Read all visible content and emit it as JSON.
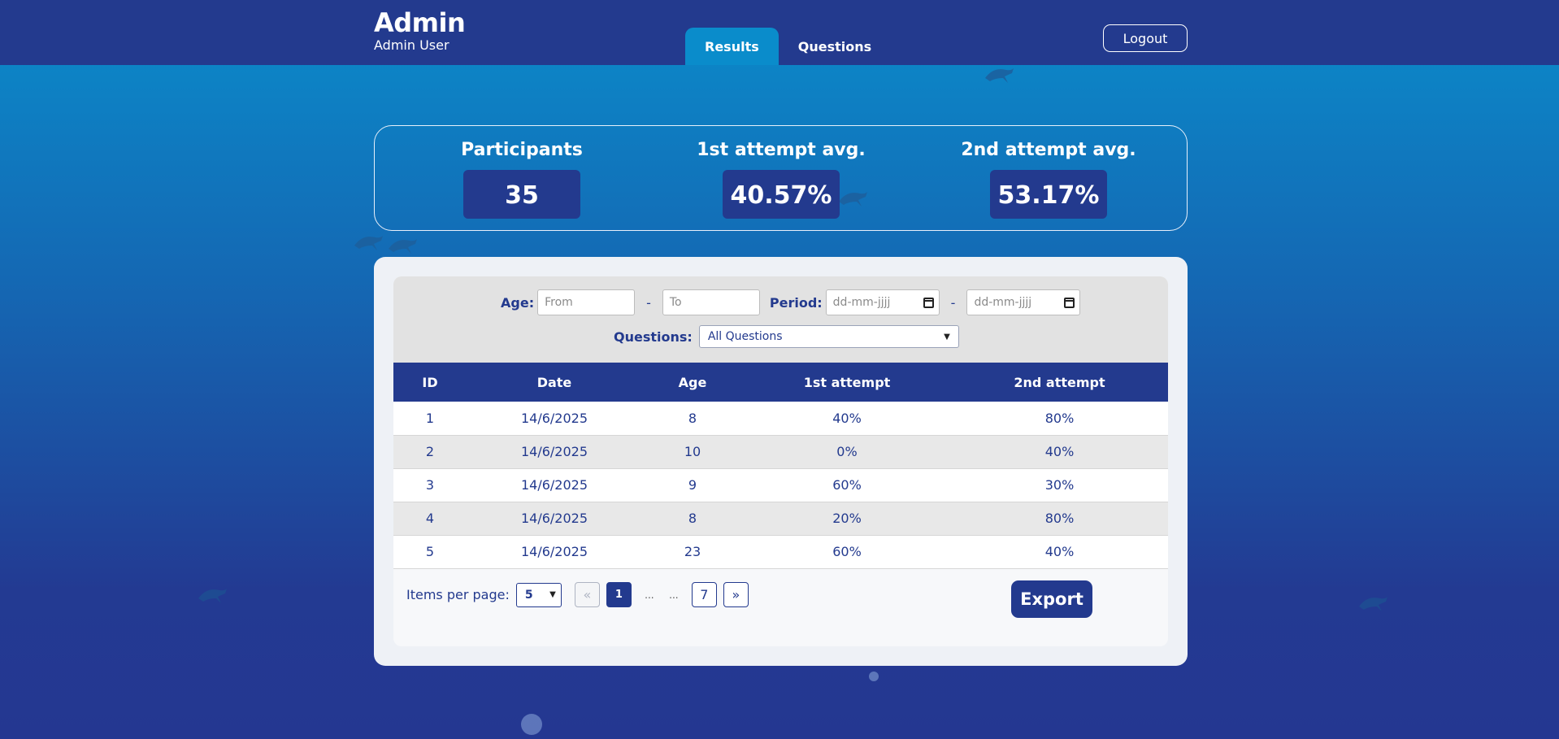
{
  "header": {
    "title": "Admin",
    "subtitle": "Admin User",
    "tabs": [
      {
        "label": "Results",
        "active": true
      },
      {
        "label": "Questions",
        "active": false
      }
    ],
    "logout_label": "Logout"
  },
  "stats": [
    {
      "label": "Participants",
      "value": "35"
    },
    {
      "label": "1st attempt avg.",
      "value": "40.57%"
    },
    {
      "label": "2nd attempt avg.",
      "value": "53.17%"
    }
  ],
  "filters": {
    "age_label": "Age:",
    "age_from_placeholder": "From",
    "age_to_placeholder": "To",
    "separator": "-",
    "period_label": "Period:",
    "date_placeholder": "dd-mm-jjjj",
    "questions_label": "Questions:",
    "questions_selected": "All Questions"
  },
  "table": {
    "columns": [
      "ID",
      "Date",
      "Age",
      "1st attempt",
      "2nd attempt"
    ],
    "rows": [
      [
        "1",
        "14/6/2025",
        "8",
        "40%",
        "80%"
      ],
      [
        "2",
        "14/6/2025",
        "10",
        "0%",
        "40%"
      ],
      [
        "3",
        "14/6/2025",
        "9",
        "60%",
        "30%"
      ],
      [
        "4",
        "14/6/2025",
        "8",
        "20%",
        "80%"
      ],
      [
        "5",
        "14/6/2025",
        "23",
        "60%",
        "40%"
      ]
    ]
  },
  "pagination": {
    "items_per_page_label": "Items per page:",
    "items_per_page_value": "5",
    "prev_label": "«",
    "current_page": "1",
    "ellipsis": "...",
    "last_page": "7",
    "next_label": "»"
  },
  "export_label": "Export",
  "colors": {
    "primary": "#233a8e",
    "accent": "#0a8ccb",
    "background_top": "#0a8ccb",
    "background_bottom": "#243791"
  }
}
